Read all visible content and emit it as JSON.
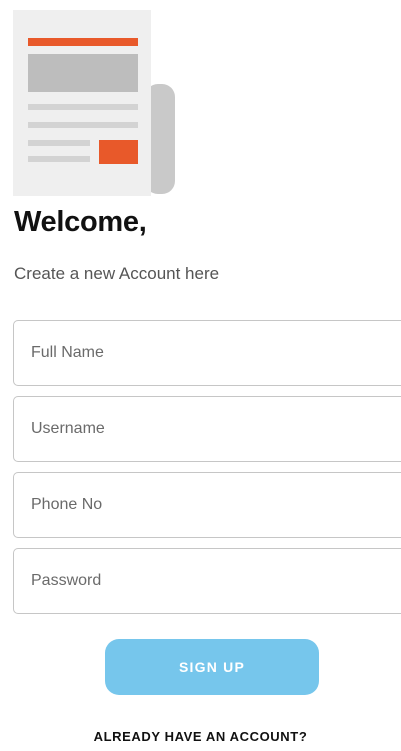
{
  "logo": {
    "icon": "newspaper-icon",
    "colors": {
      "accent": "#e8592a",
      "grey": "#bdbdbd",
      "paper": "#efefef"
    }
  },
  "header": {
    "title": "Welcome,",
    "subtitle": "Create a new Account here"
  },
  "form": {
    "full_name": {
      "placeholder": "Full Name",
      "value": ""
    },
    "username": {
      "placeholder": "Username",
      "value": ""
    },
    "phone": {
      "placeholder": "Phone No",
      "value": ""
    },
    "password": {
      "placeholder": "Password",
      "value": ""
    }
  },
  "actions": {
    "signup_label": "SIGN UP",
    "signup_color": "#76c6ec",
    "login_link": "ALREADY HAVE AN ACCOUNT?"
  }
}
